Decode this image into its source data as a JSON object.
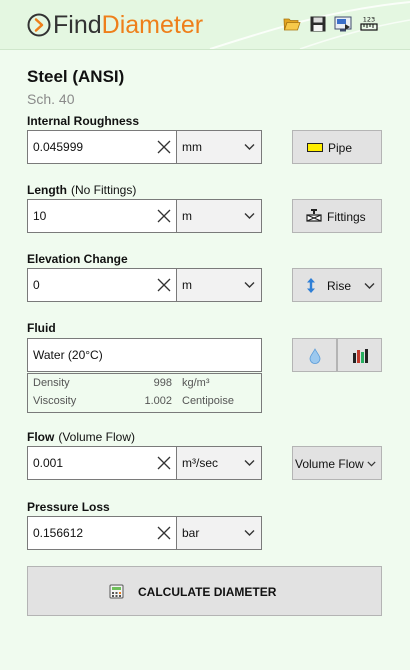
{
  "app": {
    "name_part1": "Find",
    "name_part2": "Diameter"
  },
  "toolbar": {
    "icons": [
      "folder-open-icon",
      "save-icon",
      "export-icon",
      "numeric-format-icon"
    ]
  },
  "material": {
    "name": "Steel (ANSI)",
    "schedule": "Sch.  40"
  },
  "roughness": {
    "label": "Internal Roughness",
    "value": "0.045999",
    "unit": "mm",
    "button": "Pipe"
  },
  "length": {
    "label": "Length",
    "note": "(No Fittings)",
    "value": "10",
    "unit": "m",
    "button": "Fittings"
  },
  "elevation": {
    "label": "Elevation Change",
    "value": "0",
    "unit": "m",
    "button": "Rise"
  },
  "fluid": {
    "label": "Fluid",
    "value": "Water (20°C)",
    "density_label": "Density",
    "density_value": "998",
    "density_unit": "kg/m³",
    "viscosity_label": "Viscosity",
    "viscosity_value": "1.002",
    "viscosity_unit": "Centipoise"
  },
  "flow": {
    "label": "Flow",
    "note": "(Volume Flow)",
    "value": "0.001",
    "unit": "m³/sec",
    "mode": "Volume Flow"
  },
  "pressure": {
    "label": "Pressure Loss",
    "value": "0.156612",
    "unit": "bar"
  },
  "calculate": {
    "label": "CALCULATE DIAMETER"
  },
  "colors": {
    "accent": "#ee7f1a",
    "background": "#f0fbef",
    "header": "#e4f7e1",
    "pipe_swatch": "#ffee00"
  }
}
